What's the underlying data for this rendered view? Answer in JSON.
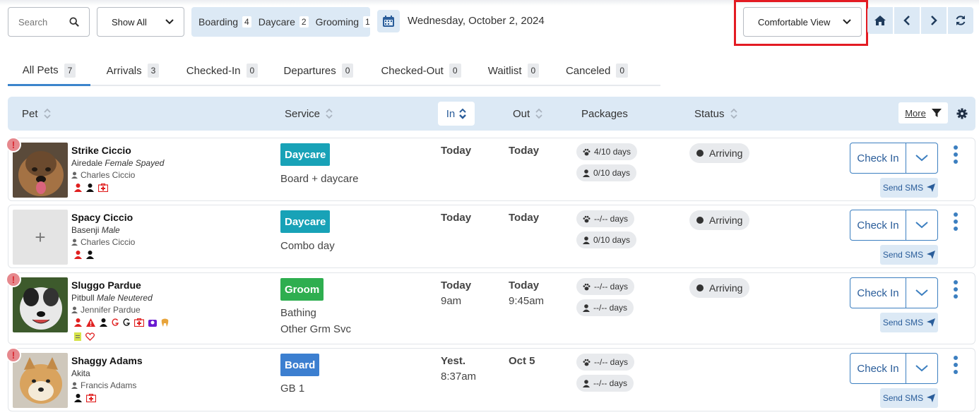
{
  "toolbar": {
    "search_placeholder": "Search",
    "filter_select": "Show All",
    "counts": [
      {
        "label": "Boarding",
        "count": "4"
      },
      {
        "label": "Daycare",
        "count": "2"
      },
      {
        "label": "Grooming",
        "count": "1"
      }
    ],
    "date": "Wednesday, October 2, 2024",
    "view_select": "Comfortable View"
  },
  "tabs": [
    {
      "label": "All Pets",
      "count": "7"
    },
    {
      "label": "Arrivals",
      "count": "3"
    },
    {
      "label": "Checked-In",
      "count": "0"
    },
    {
      "label": "Departures",
      "count": "0"
    },
    {
      "label": "Checked-Out",
      "count": "0"
    },
    {
      "label": "Waitlist",
      "count": "0"
    },
    {
      "label": "Canceled",
      "count": "0"
    }
  ],
  "columns": {
    "pet": "Pet",
    "service": "Service",
    "in": "In",
    "out": "Out",
    "packages": "Packages",
    "status": "Status",
    "more": "More"
  },
  "rows": [
    {
      "name": "Strike Ciccio",
      "breed": "Airedale",
      "breed_detail": "Female Spayed",
      "owner": "Charles Ciccio",
      "service": "Daycare",
      "service_detail": "Board + daycare",
      "service_detail2": "",
      "in_day": "Today",
      "in_time": "",
      "out_day": "Today",
      "out_time": "",
      "pkg1": "4/10 days",
      "pkg2": "0/10 days",
      "status": "Arriving",
      "checkin": "Check In",
      "sms": "Send SMS"
    },
    {
      "name": "Spacy Ciccio",
      "breed": "Basenji",
      "breed_detail": "Male",
      "owner": "Charles Ciccio",
      "service": "Daycare",
      "service_detail": "Combo day",
      "service_detail2": "",
      "in_day": "Today",
      "in_time": "",
      "out_day": "Today",
      "out_time": "",
      "pkg1": "--/-- days",
      "pkg2": "0/10 days",
      "status": "Arriving",
      "checkin": "Check In",
      "sms": "Send SMS"
    },
    {
      "name": "Sluggo Pardue",
      "breed": "Pitbull",
      "breed_detail": "Male Neutered",
      "owner": "Jennifer Pardue",
      "service": "Groom",
      "service_detail": "Bathing",
      "service_detail2": "Other Grm Svc",
      "in_day": "Today",
      "in_time": "9am",
      "out_day": "Today",
      "out_time": "9:45am",
      "pkg1": "--/-- days",
      "pkg2": "--/-- days",
      "status": "Arriving",
      "checkin": "Check In",
      "sms": "Send SMS"
    },
    {
      "name": "Shaggy Adams",
      "breed": "Akita",
      "breed_detail": "",
      "owner": "Francis Adams",
      "service": "Board",
      "service_detail": "GB 1",
      "service_detail2": "",
      "in_day": "Yest.",
      "in_time": "8:37am",
      "out_day": "Oct 5",
      "out_time": "",
      "pkg1": "--/-- days",
      "pkg2": "--/-- days",
      "status": "",
      "checkin": "Check In",
      "sms": "Send SMS"
    }
  ],
  "photo_placeholder": "+",
  "colors": {
    "accent": "#3c7fc0",
    "daycare": "#18a2b7",
    "groom": "#2eae4f",
    "board": "#3c7fd0",
    "highlight": "#e31b23"
  },
  "icons": [
    "search-icon",
    "chevron-down-icon",
    "calendar-icon",
    "home-icon",
    "chevron-left-icon",
    "chevron-right-icon",
    "refresh-icon",
    "filter-icon",
    "gear-icon",
    "user-icon",
    "paw-icon",
    "paper-plane-icon",
    "alert-icon"
  ]
}
